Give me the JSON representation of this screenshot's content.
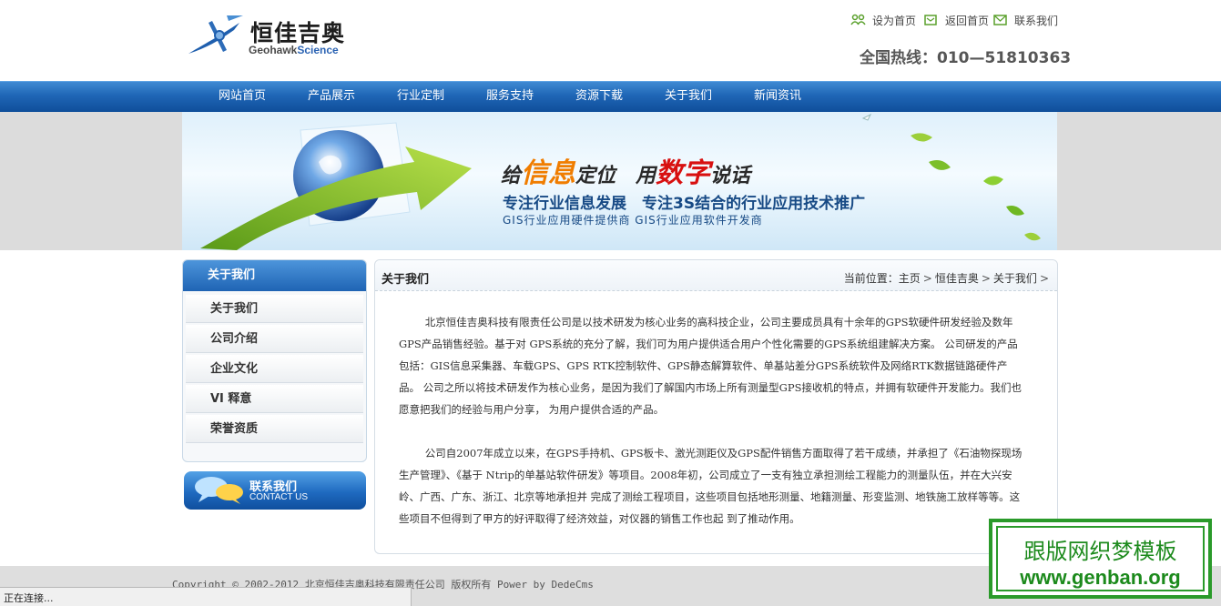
{
  "header": {
    "logo_cn": "恒佳吉奥",
    "logo_en_a": "Geohawk",
    "logo_en_b": "Science",
    "toplinks": [
      {
        "label": "设为首页",
        "icon": "people-icon"
      },
      {
        "label": "返回首页",
        "icon": "home-icon"
      },
      {
        "label": "联系我们",
        "icon": "mail-icon"
      }
    ],
    "hotline": "全国热线：010—51810363"
  },
  "nav": {
    "items": [
      "网站首页",
      "产品展示",
      "行业定制",
      "服务支持",
      "资源下载",
      "关于我们",
      "新闻资讯"
    ]
  },
  "banner": {
    "slogan_a": "给",
    "slogan_b": "信息",
    "slogan_c": "定位　用",
    "slogan_d": "数字",
    "slogan_e": "说话",
    "line1": "专注行业信息发展　专注3S结合的行业应用技术推广",
    "line2": "GIS行业应用硬件提供商 GIS行业应用软件开发商"
  },
  "sidebar": {
    "title": "关于我们",
    "items": [
      "关于我们",
      "公司介绍",
      "企业文化",
      "VI 释意",
      "荣誉资质"
    ],
    "contact_cn": "联系我们",
    "contact_en": "CONTACT US"
  },
  "main": {
    "title": "关于我们",
    "breadcrumb": {
      "prefix": "当前位置：",
      "items": [
        "主页",
        "恒佳吉奥",
        "关于我们"
      ],
      "sep": ">"
    },
    "paragraphs": [
      "北京恒佳吉奥科技有限责任公司是以技术研发为核心业务的高科技企业，公司主要成员具有十余年的GPS软硬件研发经验及数年GPS产品销售经验。基于对 GPS系统的充分了解，我们可为用户提供适合用户个性化需要的GPS系统组建解决方案。 公司研发的产品包括：GIS信息采集器、车载GPS、GPS RTK控制软件、GPS静态解算软件、单基站差分GPS系统软件及网络RTK数据链路硬件产品。 公司之所以将技术研发作为核心业务，是因为我们了解国内市场上所有测量型GPS接收机的特点，并拥有软硬件开发能力。我们也愿意把我们的经验与用户分享， 为用户提供合适的产品。",
      "公司自2007年成立以来，在GPS手持机、GPS板卡、激光测距仪及GPS配件销售方面取得了若干成绩，并承担了《石油物探现场生产管理》、《基于 Ntrip的单基站软件研发》等项目。2008年初，公司成立了一支有独立承担测绘工程能力的测量队伍，并在大兴安岭、广西、广东、浙江、北京等地承担并 完成了测绘工程项目，这些项目包括地形测量、地籍测量、形变监测、地铁施工放样等等。这些项目不但得到了甲方的好评取得了经济效益，对仪器的销售工作也起 到了推动作用。"
    ]
  },
  "footer": {
    "copyright": "Copyright © 2002-2012 北京恒佳吉奥科技有限责任公司 版权所有 Power by DedeCms"
  },
  "statusbar": {
    "text": "正在连接..."
  },
  "watermark": {
    "cn": "跟版网织梦模板",
    "en": "www.genban.org"
  },
  "colors": {
    "nav_blue": "#1f66b6",
    "watermark_green": "#2a9a2a",
    "slogan_orange": "#f07d00",
    "slogan_red": "#d81010"
  }
}
